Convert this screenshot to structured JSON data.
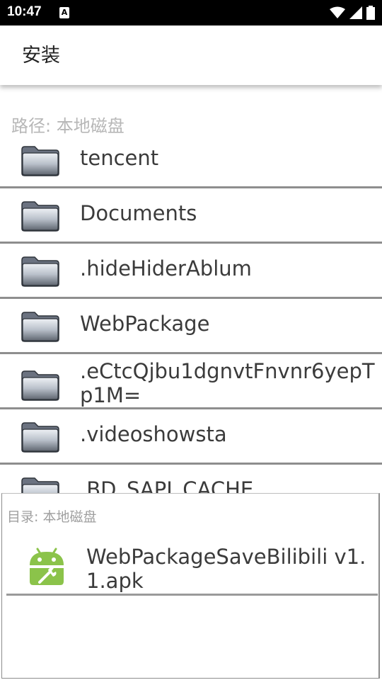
{
  "status_bar": {
    "time": "10:47",
    "notification_badge": "A",
    "icons": [
      "wifi-icon",
      "signal-icon",
      "battery-icon"
    ]
  },
  "header": {
    "title": "安装"
  },
  "path": {
    "label": "路径:  本地磁盘"
  },
  "folders": [
    {
      "name": "tencent",
      "icon": "folder-icon"
    },
    {
      "name": "Documents",
      "icon": "folder-icon"
    },
    {
      "name": ".hideHiderAblum",
      "icon": "folder-icon"
    },
    {
      "name": "WebPackage",
      "icon": "folder-icon"
    },
    {
      "name": ".eCtcQjbu1dgnvtFnvnr6yepTp1M=",
      "icon": "folder-icon"
    },
    {
      "name": ".videoshowsta",
      "icon": "folder-icon"
    },
    {
      "name": ".BD_SAPI_CACHE",
      "icon": "folder-icon"
    }
  ],
  "dialog": {
    "dir_label": "目录:   本地磁盘",
    "files": [
      {
        "name": "WebPackageSaveBilibili v1.1.apk",
        "icon": "android-apk-icon"
      }
    ]
  },
  "colors": {
    "apk_green": "#8bc34a",
    "divider": "#8e8e8e",
    "muted_text": "#b7b7b7"
  }
}
